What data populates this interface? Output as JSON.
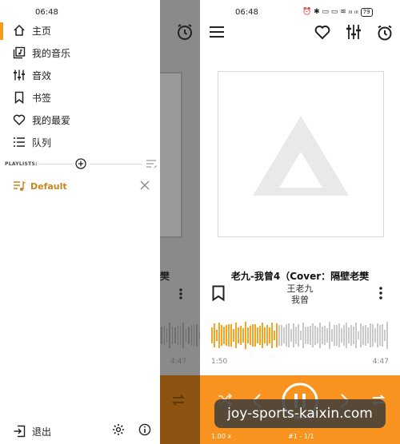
{
  "status_bar": {
    "time_left": "06:48",
    "time_right": "06:48",
    "icons_text": "⏰ ✱ ▭ ▭ ≋ ᵢₗₗ ᵢₗₗ",
    "battery": "79"
  },
  "drawer": {
    "items": [
      {
        "label": "主页",
        "icon": "home-icon"
      },
      {
        "label": "我的音乐",
        "icon": "music-library-icon"
      },
      {
        "label": "音效",
        "icon": "equalizer-icon"
      },
      {
        "label": "书签",
        "icon": "bookmark-icon"
      },
      {
        "label": "我的最爱",
        "icon": "heart-icon"
      },
      {
        "label": "队列",
        "icon": "queue-icon"
      }
    ],
    "playlists_label": "PLAYLISTS:",
    "playlist_default": "Default",
    "exit_label": "退出"
  },
  "player": {
    "title": "老九-我曾4（Cover：隔壁老樊",
    "artist": "王老九",
    "album": "我曾",
    "elapsed": "1:50",
    "duration": "4:47",
    "dim_duration": "4:47",
    "speed": "1.00 x",
    "track_position": "#1 - 1/1",
    "progress": 0.38
  },
  "watermark": "joy-sports-kaixin.com",
  "colors": {
    "accent": "#f7931e",
    "playlist_text": "#c8841a",
    "wave_played": "#f5a524",
    "wave_unplayed": "#c9c9c9"
  }
}
